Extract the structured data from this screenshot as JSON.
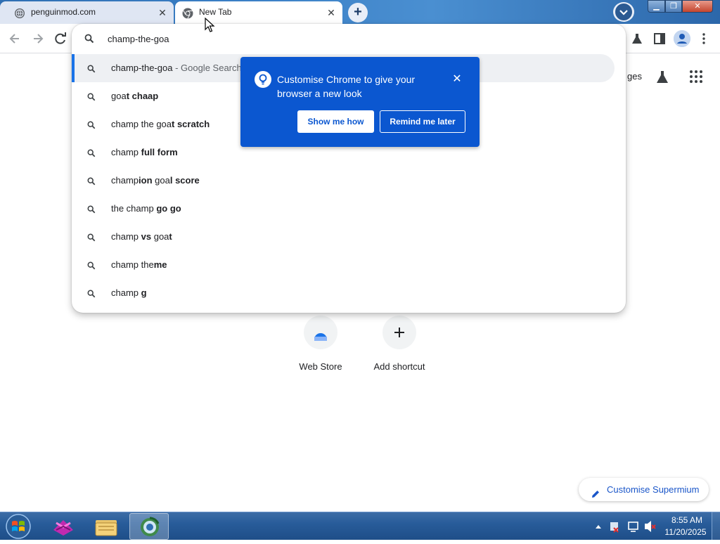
{
  "browser": {
    "tabs": [
      {
        "title": "penguinmod.com"
      },
      {
        "title": "New Tab"
      }
    ]
  },
  "omnibox": {
    "value": "champ-the-goa",
    "suggestions": [
      {
        "typed": "champ-the-goa",
        "bold": "",
        "suffix": " - Google Search"
      },
      {
        "typed": "goa",
        "bold": "t chaap",
        "suffix": ""
      },
      {
        "typed": "champ the goa",
        "bold": "t scratch",
        "suffix": ""
      },
      {
        "typed": "champ ",
        "bold": "full form",
        "suffix": ""
      },
      {
        "typed": "champ",
        "bold": "ion",
        "mid": " goa",
        "bold2": "l score",
        "suffix": ""
      },
      {
        "typed": "the champ ",
        "bold": "go go",
        "suffix": ""
      },
      {
        "typed": "champ ",
        "bold": "vs",
        "mid": " goa",
        "bold2": "t",
        "suffix": ""
      },
      {
        "typed": "champ the",
        "bold": "me",
        "suffix": ""
      },
      {
        "typed": "champ ",
        "bold": "g",
        "suffix": ""
      }
    ]
  },
  "promo": {
    "message": "Customise Chrome to give your browser a new look",
    "primary_label": "Show me how",
    "secondary_label": "Remind me later",
    "accent_color": "#0b57d0"
  },
  "ntp": {
    "images_link": "ges",
    "shortcuts": [
      {
        "label": "Web Store"
      },
      {
        "label": "Add shortcut"
      }
    ],
    "customise_label": "Customise Supermium"
  },
  "taskbar": {
    "time": "8:55 AM",
    "date": "11/20/2025"
  }
}
